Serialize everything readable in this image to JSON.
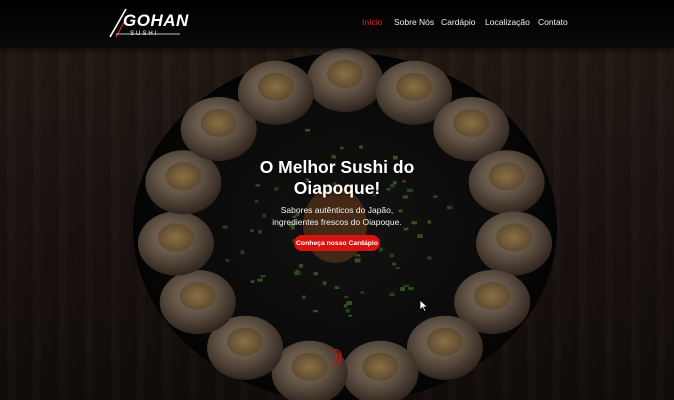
{
  "brand": {
    "logo_word": "GOHAN",
    "logo_sub": "SUSHI",
    "accent_color": "#e2231a"
  },
  "nav": {
    "items": [
      {
        "label": "Início",
        "active": true
      },
      {
        "label": "Sobre Nós",
        "active": false
      },
      {
        "label": "Cardápio",
        "active": false
      },
      {
        "label": "Localização",
        "active": false
      },
      {
        "label": "Contato",
        "active": false
      }
    ]
  },
  "hero": {
    "title_line1": "O Melhor Sushi do",
    "title_line2": "Oiapoque!",
    "subtitle_line1": "Sabores autênticos do Japão,",
    "subtitle_line2": "ingredientes frescos do Oiapoque.",
    "cta_label": "Conheça nosso Cardápio",
    "cta_color": "#d8120e",
    "background_image": "sushi-platter-photo"
  },
  "icons": {
    "scroll": "scroll-down-mouse-icon",
    "cursor": "mouse-pointer-icon"
  }
}
